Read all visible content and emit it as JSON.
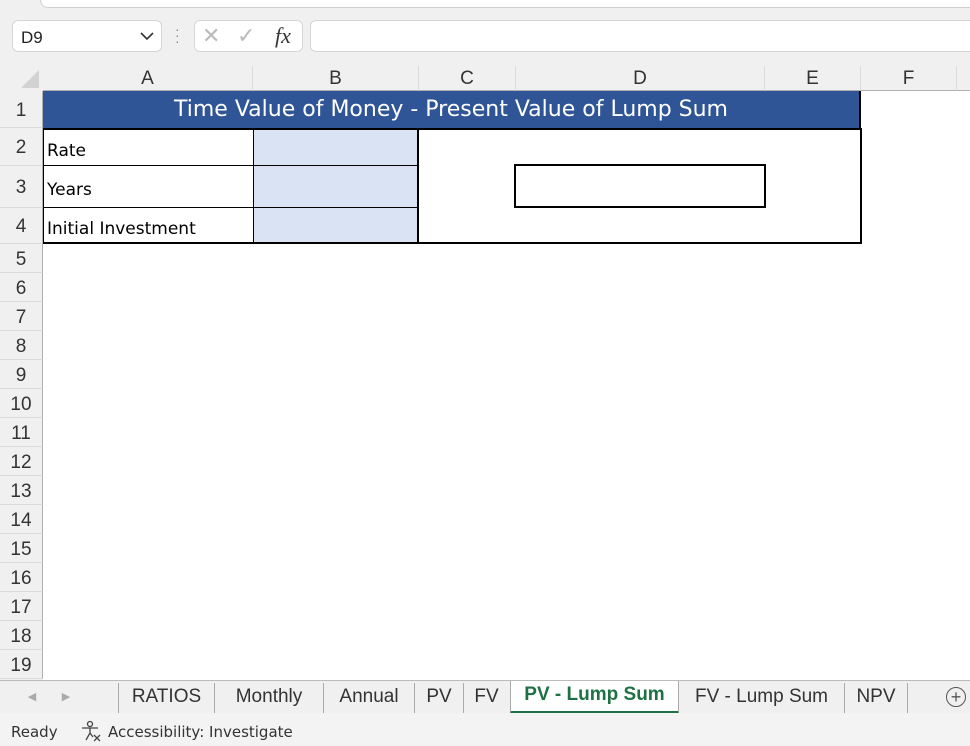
{
  "formula_bar": {
    "name_box": "D9",
    "cancel_icon": "✕",
    "enter_icon": "✓",
    "fx_label": "fx",
    "formula": ""
  },
  "columns": [
    "A",
    "B",
    "C",
    "D",
    "E",
    "F"
  ],
  "rows": [
    "1",
    "2",
    "3",
    "4",
    "5",
    "6",
    "7",
    "8",
    "9",
    "10",
    "11",
    "12",
    "13",
    "14",
    "15",
    "16",
    "17",
    "18",
    "19"
  ],
  "sheet": {
    "title": "Time Value of Money - Present Value of Lump Sum",
    "labels": [
      "Rate",
      "Years",
      "Initial Investment"
    ],
    "inputs": [
      "",
      "",
      ""
    ],
    "result": "",
    "input_fill": "#dae3f3",
    "title_fill": "#2f5597"
  },
  "tabs": [
    {
      "label": "RATIOS",
      "active": false
    },
    {
      "label": "Monthly",
      "active": false
    },
    {
      "label": "Annual",
      "active": false
    },
    {
      "label": "PV",
      "active": false
    },
    {
      "label": "FV",
      "active": false
    },
    {
      "label": "PV - Lump Sum",
      "active": true
    },
    {
      "label": "FV - Lump Sum",
      "active": false
    },
    {
      "label": "NPV",
      "active": false
    }
  ],
  "tab_nav": {
    "prev": "◀",
    "next": "▶",
    "add": "+"
  },
  "status": {
    "ready": "Ready",
    "accessibility": "Accessibility: Investigate"
  }
}
